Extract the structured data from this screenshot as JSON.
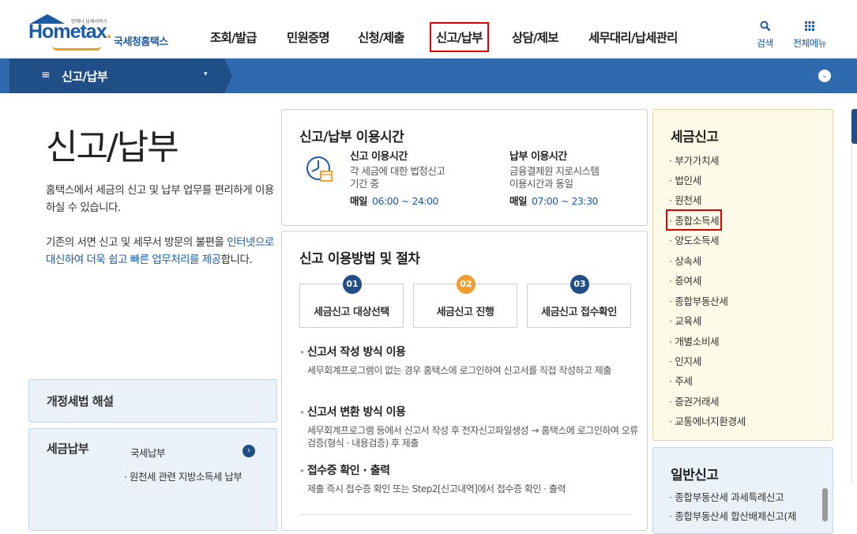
{
  "header": {
    "logo_small": "언제나 납세서비스",
    "logo_home": "Hom",
    "logo_e": "e",
    "logo_tax": "tax",
    "logo_dot": ".",
    "logo_kr": "국세청홈택스",
    "gnb": [
      "조회/발급",
      "민원증명",
      "신청/제출",
      "신고/납부",
      "상담/제보",
      "세무대리/납세관리"
    ],
    "active_gnb": "신고/납부",
    "search_icon": "search-icon",
    "search_label": "검색",
    "menu_icon": "grid-menu-icon",
    "menu_label": "전체메뉴"
  },
  "navbar": {
    "menu_icon": "≡",
    "title": "신고/납부",
    "dropdown_icon": "▾",
    "circle_icon": "⌄"
  },
  "intro": {
    "title": "신고/납부",
    "desc1": "홈택스에서 세금의 신고 및 납부 업무를 편리하게 이용하실 수 있습니다.",
    "desc2_plain": "기존의 서면 신고 및 세무서 방문의 불편을 ",
    "desc2_blue": "인터넷으로 대신하여 더욱 쉽고 빠른 업무처리를 제공",
    "desc2_end": "합니다."
  },
  "left_boxes": {
    "law_title": "개정세법 해설",
    "pay_title": "세금납부",
    "pay_link": "국세납부",
    "pay_go_icon": "›",
    "pay_sub": "· 원천세 관련 지방소득세 납부"
  },
  "usage_time": {
    "title": "신고/납부 이용시간",
    "report": {
      "title": "신고 이용시간",
      "desc1": "각 세금에 대한 법정신고",
      "desc2": "기간 중",
      "daily": "매일",
      "time": "06:00 ~ 24:00"
    },
    "pay": {
      "title": "납부 이용시간",
      "desc1": "금융결제원 지로시스템",
      "desc2": "이용시간과 동일",
      "daily": "매일",
      "time": "07:00 ~ 23:30"
    }
  },
  "procedure": {
    "title": "신고 이용방법 및 절차",
    "steps": [
      {
        "num": "01",
        "label": "세금신고 대상선택"
      },
      {
        "num": "02",
        "label": "세금신고 진행"
      },
      {
        "num": "03",
        "label": "세금신고 접수확인"
      }
    ],
    "items": [
      {
        "title": "신고서 작성 방식 이용",
        "desc": "세무회계프로그램이 없는 경우 홈택스에 로그인하여 신고서를 직접 작성하고 제출"
      },
      {
        "title": "신고서 변환 방식 이용",
        "desc": "세무회계프로그램 등에서 신고서 작성 후 전자신고파일생성 → 홈택스에 로그인하여 오류검증(형식 · 내용검증) 후 제출"
      },
      {
        "title": "접수증 확인 · 출력",
        "desc": "제출 즉시 접수증 확인 또는 Step2[신고내역]에서 접수증 확인 · 출력"
      }
    ]
  },
  "tax_report": {
    "title": "세금신고",
    "items": [
      "부가가치세",
      "법인세",
      "원천세",
      "종합소득세",
      "양도소득세",
      "상속세",
      "증여세",
      "종합부동산세",
      "교육세",
      "개별소비세",
      "인지세",
      "주세",
      "증권거래세",
      "교통에너지환경세"
    ],
    "highlighted": "종합소득세"
  },
  "general_report": {
    "title": "일반신고",
    "items": [
      "종합부동산세 과세특례신고",
      "종합부동산세 합산배제신고(제"
    ]
  }
}
